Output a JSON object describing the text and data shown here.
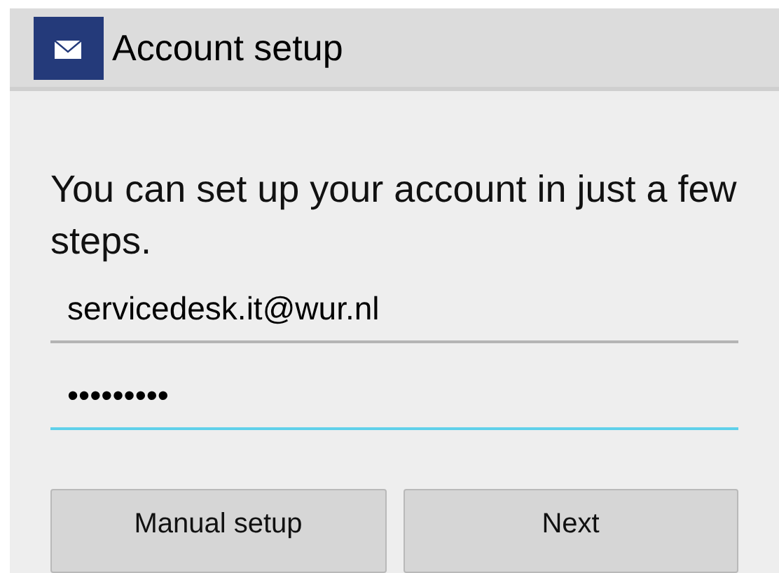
{
  "header": {
    "title": "Account setup"
  },
  "prompt": "You can set up your account in just a few steps.",
  "fields": [
    {
      "value": "servicedesk.it@wur.nl",
      "focused": false
    },
    {
      "value": "•••••••••",
      "focused": true
    }
  ],
  "buttons": [
    "Manual setup",
    "Next"
  ]
}
